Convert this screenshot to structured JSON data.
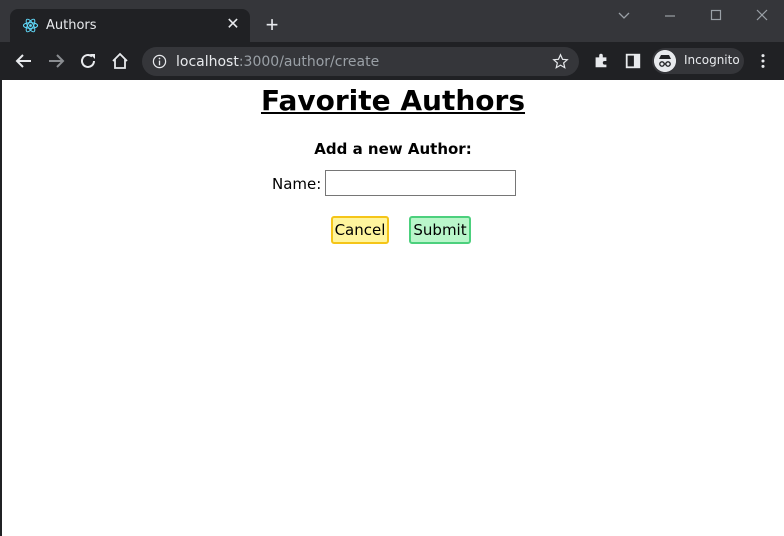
{
  "browser": {
    "tab": {
      "title": "Authors",
      "favicon": "react-icon"
    },
    "address": {
      "host": "localhost",
      "rest": ":3000/author/create"
    },
    "profile_label": "Incognito"
  },
  "page": {
    "title": "Favorite Authors",
    "form_heading": "Add a new Author:",
    "name_label": "Name:",
    "name_value": "",
    "cancel_label": "Cancel",
    "submit_label": "Submit"
  },
  "colors": {
    "chrome_dark": "#202124",
    "cancel_bg": "#fff59d",
    "cancel_border": "#f5c518",
    "submit_bg": "#b9f6ca",
    "submit_border": "#4cd07d"
  }
}
